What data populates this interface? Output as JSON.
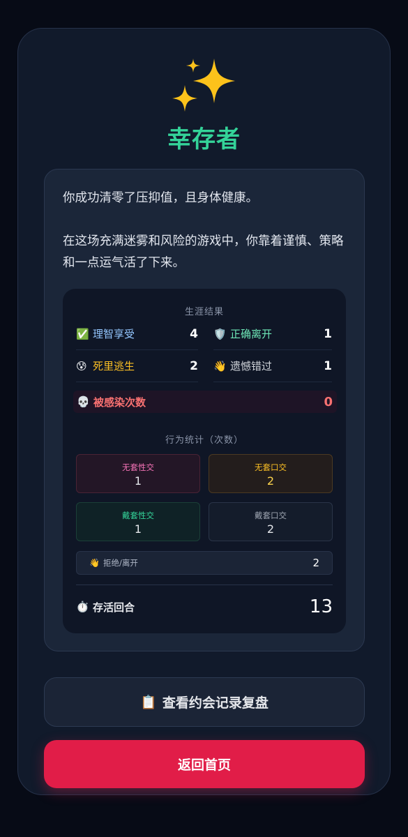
{
  "result": {
    "title": "幸存者",
    "message_1": "你成功清零了压抑值，且身体健康。",
    "message_2": "在这场充满迷雾和风险的游戏中，你靠着谨慎、策略和一点运气活了下来。"
  },
  "career": {
    "title": "生涯结果",
    "items": [
      {
        "icon": "✅",
        "label": "理智享受",
        "value": "4",
        "color": "#93c5fd"
      },
      {
        "icon": "🛡️",
        "label": "正确离开",
        "value": "1",
        "color": "#6ee7b7"
      },
      {
        "icon": "😰",
        "label": "死里逃生",
        "value": "2",
        "color": "#fbbf24"
      },
      {
        "icon": "👋",
        "label": "遗憾错过",
        "value": "1",
        "color": "#d1d5db"
      }
    ],
    "infected": {
      "icon": "💀",
      "label": "被感染次数",
      "value": "0",
      "color": "#f87171"
    }
  },
  "behavior": {
    "title": "行为统计（次数）",
    "boxes": [
      {
        "label": "无套性交",
        "value": "1",
        "label_color": "#f472b6",
        "value_color": "#e5e7eb",
        "bg": "#231626",
        "border": "#4a2335"
      },
      {
        "label": "无套口交",
        "value": "2",
        "label_color": "#fbbf24",
        "value_color": "#fcd34d",
        "bg": "#231d1c",
        "border": "#4c3a22"
      },
      {
        "label": "戴套性交",
        "value": "1",
        "label_color": "#34d399",
        "value_color": "#e5e7eb",
        "bg": "#0f2226",
        "border": "#1b4038"
      },
      {
        "label": "戴套口交",
        "value": "2",
        "label_color": "#9ca3af",
        "value_color": "#e5e7eb",
        "bg": "#141c2b",
        "border": "#2a3448"
      }
    ],
    "reject": {
      "icon": "👋",
      "label": "拒绝/离开",
      "value": "2"
    }
  },
  "survival": {
    "icon": "⏱️",
    "label": "存活回合",
    "value": "13"
  },
  "buttons": {
    "review_icon": "📋",
    "review_label": "查看约会记录复盘",
    "home_label": "返回首页"
  },
  "icons": {
    "hero": "sparkles-icon"
  }
}
